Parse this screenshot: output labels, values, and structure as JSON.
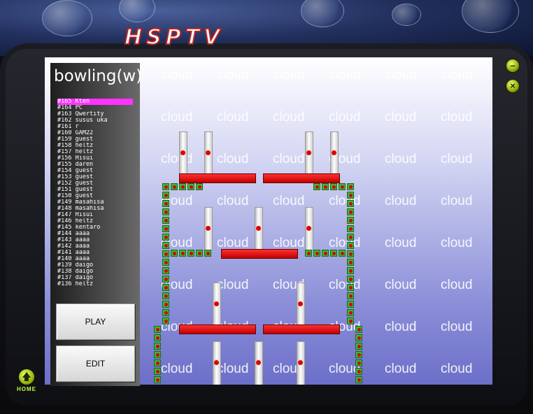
{
  "app": {
    "logo_text": "HSPTV",
    "game_title": "bowling(w)",
    "home_label": "HOME"
  },
  "colors": {
    "selected_item_bg": "#ff33ff",
    "brick": "#3db53d",
    "brick_dot": "#d80000",
    "bar": "#e00000",
    "screen_top": "#ffffff",
    "screen_bottom": "#6c6fc8"
  },
  "levels": [
    {
      "label": "#165 Kten",
      "selected": true
    },
    {
      "label": "#164 PC"
    },
    {
      "label": "#163 Qwertity"
    },
    {
      "label": "#162 susus uka"
    },
    {
      "label": "#161 r"
    },
    {
      "label": "#160 GAM22"
    },
    {
      "label": "#159 guest"
    },
    {
      "label": "#158 heltz"
    },
    {
      "label": "#157 heltz"
    },
    {
      "label": "#156 Hisui"
    },
    {
      "label": "#155 daren"
    },
    {
      "label": "#154 guest"
    },
    {
      "label": "#153 guest"
    },
    {
      "label": "#152 guest"
    },
    {
      "label": "#151 guest"
    },
    {
      "label": "#150 guest"
    },
    {
      "label": "#149 masahisa"
    },
    {
      "label": "#148 masahisa"
    },
    {
      "label": "#147 Hisui"
    },
    {
      "label": "#146 heltz"
    },
    {
      "label": "#145 kentaro"
    },
    {
      "label": "#144 aaaa"
    },
    {
      "label": "#143 aaaa"
    },
    {
      "label": "#142 aaaa"
    },
    {
      "label": "#141 aaaa"
    },
    {
      "label": "#140 aaaa"
    },
    {
      "label": "#139 daigo"
    },
    {
      "label": "#138 daigo"
    },
    {
      "label": "#137 daigo"
    },
    {
      "label": "#136 heltz"
    }
  ],
  "buttons": {
    "play": "PLAY",
    "edit": "EDIT"
  },
  "background_word": "cloud",
  "window_controls": {
    "minimize_icon": "minus-icon",
    "close_icon": "x-icon"
  }
}
